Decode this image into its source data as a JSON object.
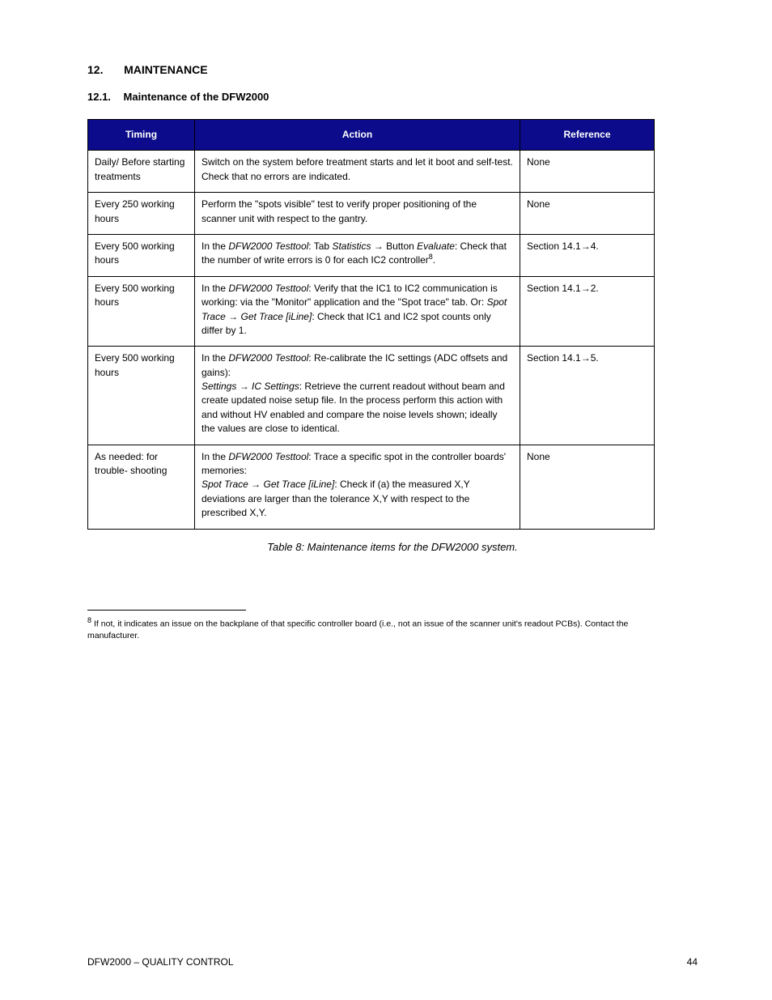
{
  "section": {
    "num": "12.",
    "title": "MAINTENANCE"
  },
  "subsection": {
    "num": "12.1.",
    "title": "Maintenance of the DFW2000"
  },
  "table": {
    "headers": [
      "Timing",
      "Action",
      "Reference"
    ],
    "rows": [
      {
        "timing": "Daily/ Before starting treatments",
        "action_html": "Switch on the system before treatment starts and let it boot and self-test. Check that no errors are indicated.",
        "ref_html": "None"
      },
      {
        "timing": "Every 250 working hours",
        "action_html": "Perform the \"spots visible\" test to verify proper positioning of the scanner unit with respect to the gantry.",
        "ref_html": "None"
      },
      {
        "timing": "Every 500 working hours",
        "action_html": "In the <i>DFW2000 Testtool</i>: Tab <i>Statistics</i> → Button <i>Evaluate</i>: Check that the number of write errors is 0 for each IC2 controller<span class=\"footnote-sup\">8</span>.",
        "ref_html": "Section 14.1→4."
      },
      {
        "timing": "Every 500 working hours",
        "action_html": "In the <i>DFW2000 Testtool</i>: Verify that the IC1 to IC2 communication is working: via the \"Monitor\" application and the \"Spot trace\" tab. Or: <i>Spot Trace</i> → <i>Get Trace [iLine]</i>: Check that IC1 and IC2 spot counts only differ by 1.",
        "ref_html": "Section 14.1→2."
      },
      {
        "timing": "Every 500 working hours",
        "action_html": "In the <i>DFW2000 Testtool</i>: Re-calibrate the IC settings (ADC offsets and gains):<br><i>Settings</i> → <i>IC Settings</i>: Retrieve the current readout without beam and create updated noise setup file. In the process perform this action with and without HV enabled and compare the noise levels shown; ideally the values are close to identical.",
        "ref_html": "Section 14.1→5."
      },
      {
        "timing": "As needed: for trouble- shooting",
        "action_html": "In the <i>DFW2000 Testtool</i>: Trace a specific spot in the controller boards' memories:<br><i>Spot Trace</i> → <i>Get Trace [iLine]</i>: Check if (a) the measured X,Y deviations are larger than the tolerance X,Y with respect to the prescribed X,Y.",
        "ref_html": "None"
      }
    ]
  },
  "caption": "Table 8: Maintenance items for the DFW2000 system.",
  "footnote": {
    "num": "8",
    "text": "If not, it indicates an issue on the backplane of that specific controller board (i.e., not an issue of the scanner unit's readout PCBs). Contact the manufacturer."
  },
  "footer": {
    "left": "DFW2000 – QUALITY CONTROL",
    "right": "44"
  }
}
